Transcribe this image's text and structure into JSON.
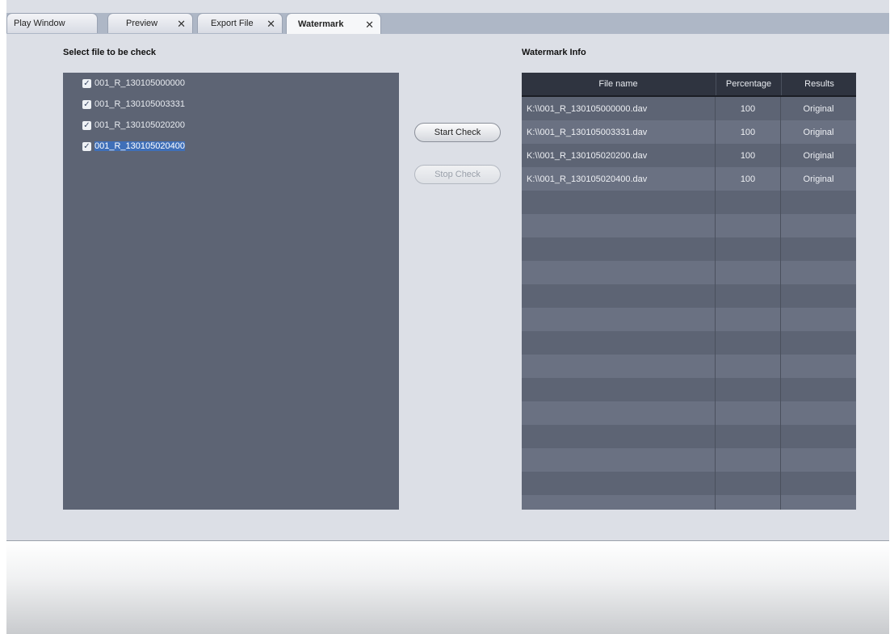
{
  "tabs": [
    {
      "label": "Play Window",
      "closable": false,
      "active": false
    },
    {
      "label": "Preview",
      "closable": true,
      "active": false
    },
    {
      "label": "Export File",
      "closable": true,
      "active": false
    },
    {
      "label": "Watermark",
      "closable": true,
      "active": true
    }
  ],
  "left_section": {
    "title": "Select file to be check",
    "files": [
      {
        "name": "001_R_130105000000",
        "checked": true
      },
      {
        "name": "001_R_130105003331",
        "checked": true
      },
      {
        "name": "001_R_130105020200",
        "checked": true
      },
      {
        "name": "001_R_130105020400",
        "checked": true,
        "selected": true
      }
    ]
  },
  "buttons": {
    "start": "Start Check",
    "stop": "Stop Check"
  },
  "right_section": {
    "title": "Watermark Info",
    "columns": [
      "File name",
      "Percentage",
      "Results"
    ],
    "rows": [
      {
        "file": "K:\\\\001_R_130105000000.dav",
        "percentage": "100",
        "result": "Original"
      },
      {
        "file": "K:\\\\001_R_130105003331.dav",
        "percentage": "100",
        "result": "Original"
      },
      {
        "file": "K:\\\\001_R_130105020200.dav",
        "percentage": "100",
        "result": "Original"
      },
      {
        "file": "K:\\\\001_R_130105020400.dav",
        "percentage": "100",
        "result": "Original"
      }
    ]
  },
  "icons": {
    "close": "close-icon",
    "check": "checkbox-checked-icon"
  },
  "colors": {
    "panel": "#5d6474",
    "table_header": "#2f3440",
    "selection": "#3f6fb8"
  }
}
